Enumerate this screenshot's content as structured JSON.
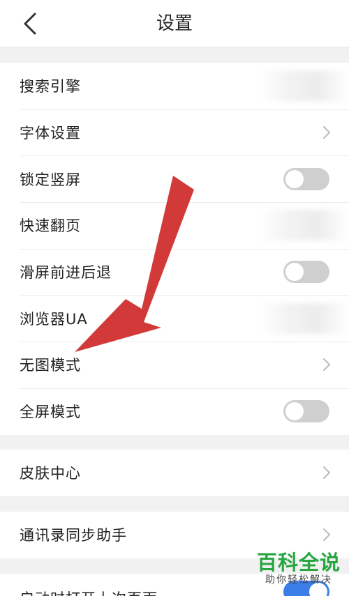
{
  "header": {
    "title": "设置"
  },
  "groups": {
    "main": [
      {
        "label": "搜索引擎"
      },
      {
        "label": "字体设置"
      },
      {
        "label": "锁定竖屏"
      },
      {
        "label": "快速翻页"
      },
      {
        "label": "滑屏前进后退"
      },
      {
        "label": "浏览器UA"
      },
      {
        "label": "无图模式"
      },
      {
        "label": "全屏模式"
      }
    ],
    "skin": [
      {
        "label": "皮肤中心"
      }
    ],
    "contacts": [
      {
        "label": "通讯录同步助手"
      }
    ],
    "startup": [
      {
        "label": "启动时打开上次页面"
      }
    ]
  },
  "toggles": {
    "lock_portrait": false,
    "swipe_nav": false,
    "fullscreen": false,
    "restore_last_page": true
  },
  "watermark": {
    "main": "百科全说",
    "sub": "助你轻松解决"
  },
  "colors": {
    "arrow": "#d23a3a",
    "watermark": "#27a640",
    "toggle_off": "#cfcfcf",
    "toggle_on": "#3b7ee8"
  }
}
